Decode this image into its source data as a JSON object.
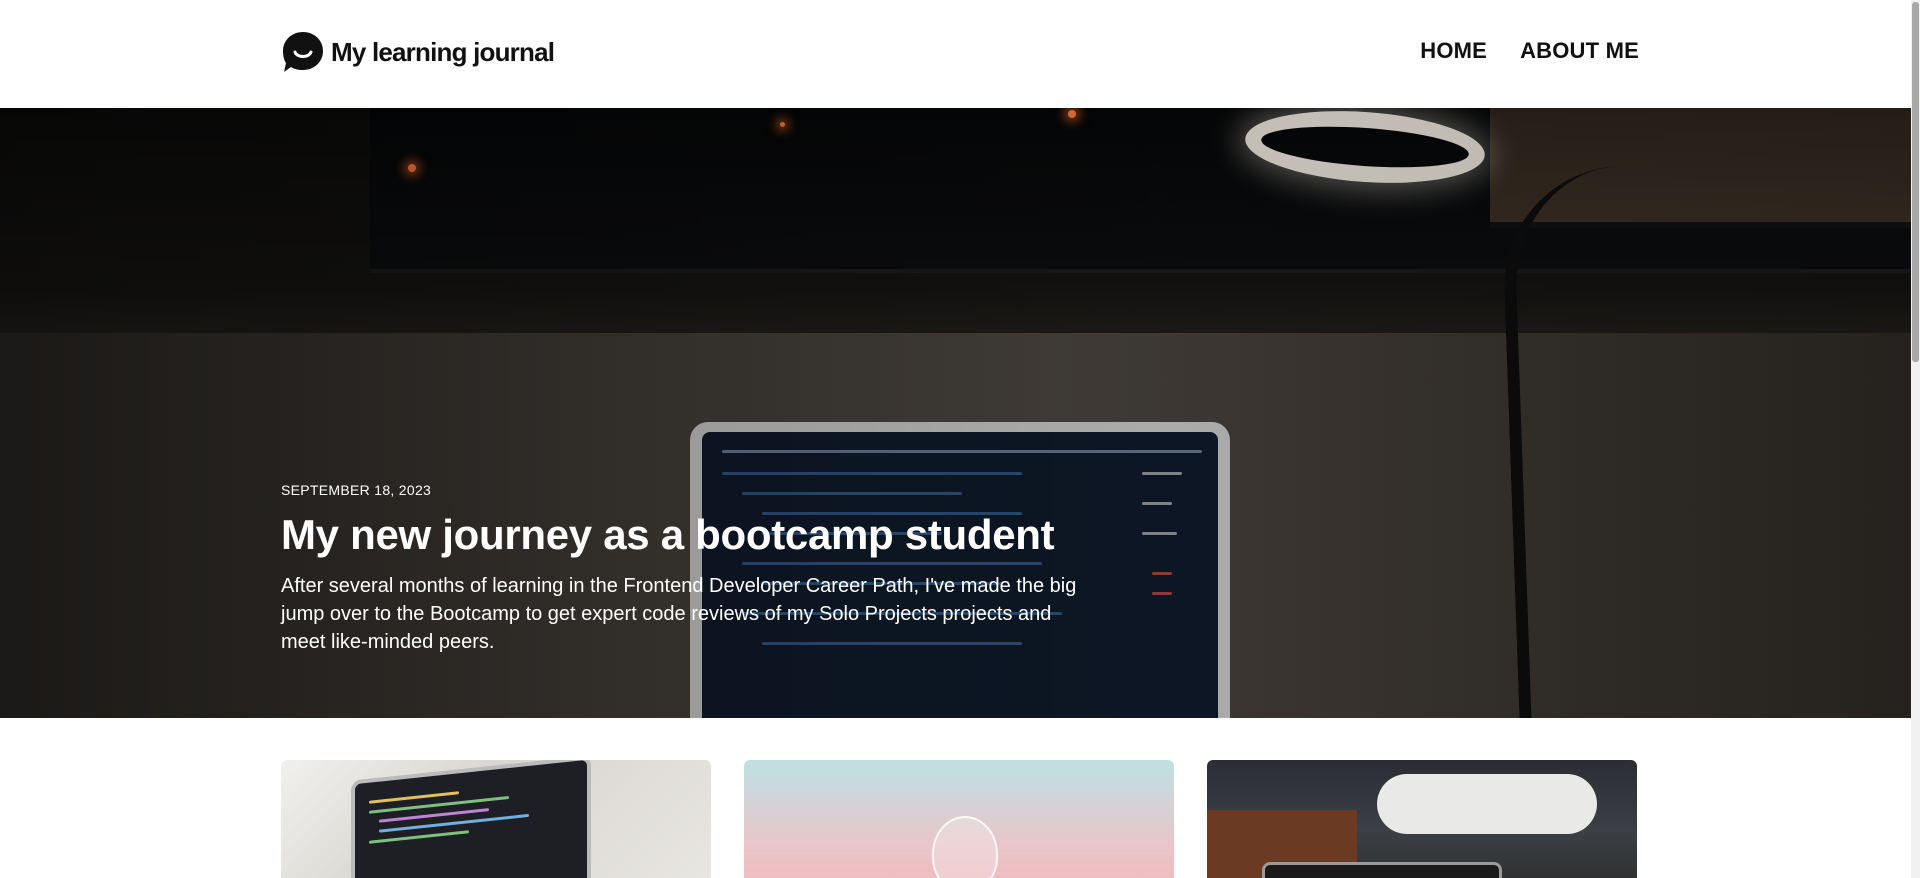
{
  "header": {
    "brand_title": "My learning journal",
    "logo_icon": "chat-bubble-smile-icon",
    "nav": [
      {
        "label": "HOME"
      },
      {
        "label": "ABOUT ME"
      }
    ]
  },
  "hero": {
    "date": "SEPTEMBER 18, 2023",
    "title": "My new journey as a bootcamp student",
    "text": "After several months of learning in the Frontend Developer Career Path, I've made the big jump over to the Bootcamp to get expert code reviews of my Solo Projects projects and meet like-minded peers.",
    "image_description_icon": "laptop-desk-lamp-photo"
  },
  "cards": [
    {
      "image": "laptop-code-photo"
    },
    {
      "image": "lightbulb-pastel-photo"
    },
    {
      "image": "office-laptop-photo"
    }
  ],
  "colors": {
    "text_dark": "#111111",
    "hero_text": "#ffffff",
    "background": "#ffffff"
  }
}
